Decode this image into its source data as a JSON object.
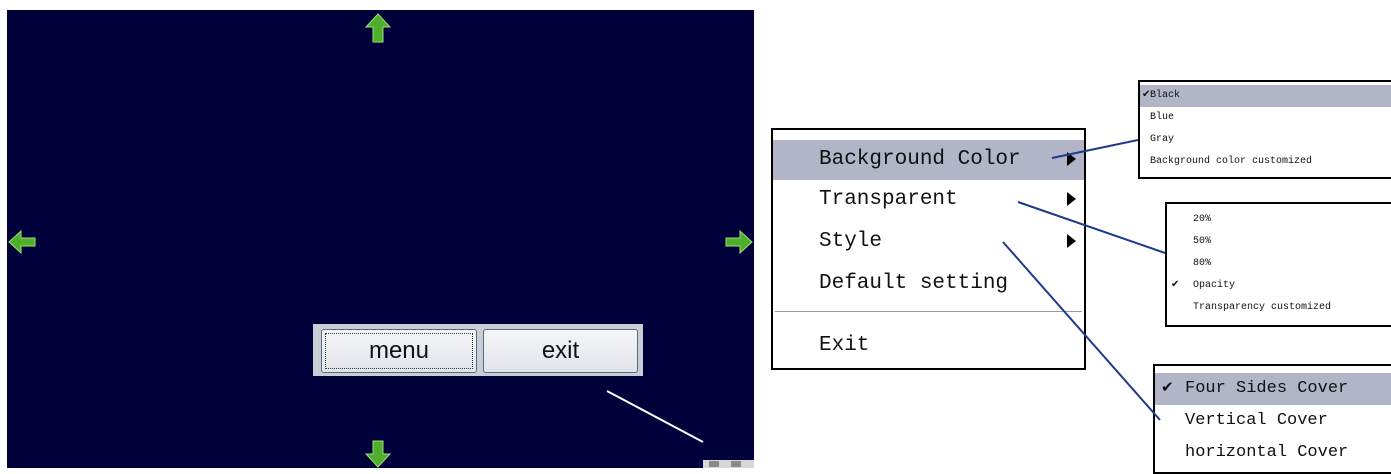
{
  "toolbar": {
    "menu_label": "menu",
    "exit_label": "exit"
  },
  "main_menu": {
    "items": [
      {
        "label": "Background Color",
        "has_submenu": true
      },
      {
        "label": "Transparent",
        "has_submenu": true
      },
      {
        "label": "Style",
        "has_submenu": true
      },
      {
        "label": "Default setting",
        "has_submenu": false
      },
      {
        "label": "Exit",
        "has_submenu": false
      }
    ]
  },
  "color_menu": {
    "items": [
      {
        "label": "Black",
        "checked": true
      },
      {
        "label": "Blue",
        "checked": false
      },
      {
        "label": "Gray",
        "checked": false
      },
      {
        "label": "Background color customized",
        "checked": false
      }
    ]
  },
  "transparent_menu": {
    "items": [
      {
        "label": "20%",
        "checked": false
      },
      {
        "label": "50%",
        "checked": false
      },
      {
        "label": "80%",
        "checked": false
      },
      {
        "label": "Opacity",
        "checked": true
      },
      {
        "label": "Transparency customized",
        "checked": false
      }
    ]
  },
  "style_menu": {
    "items": [
      {
        "label": "Four Sides Cover",
        "checked": true
      },
      {
        "label": "Vertical Cover",
        "checked": false
      },
      {
        "label": "horizontal Cover",
        "checked": false
      }
    ]
  },
  "check_glyph": "✔",
  "colors": {
    "screen_bg": "#00003a",
    "arrow_green": "#4fae2a",
    "highlight": "#b2b4c7",
    "callout_line": "#1f3a8a"
  }
}
